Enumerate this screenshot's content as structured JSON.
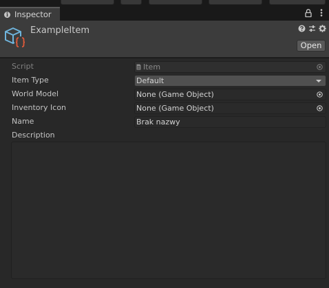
{
  "window": {
    "tab_title": "Inspector",
    "icons": [
      "info-icon",
      "lock-icon",
      "menu-icon"
    ]
  },
  "header": {
    "object_name": "ExampleItem",
    "open_label": "Open",
    "icons": [
      "script-icon",
      "help-icon",
      "presets-icon",
      "gear-icon"
    ]
  },
  "fields": {
    "script": {
      "label": "Script",
      "value": "Item"
    },
    "item_type": {
      "label": "Item Type",
      "value": "Default"
    },
    "world_model": {
      "label": "World Model",
      "value": "None (Game Object)"
    },
    "inventory_icon": {
      "label": "Inventory Icon",
      "value": "None (Game Object)"
    },
    "name": {
      "label": "Name",
      "value": "Brak nazwy"
    },
    "description": {
      "label": "Description",
      "value": ""
    }
  },
  "colors": {
    "panel_bg": "#282828",
    "header_bg": "#3c3c3c",
    "script_icon_cube": "#6fb4dc",
    "script_icon_braces": "#e05a3a"
  }
}
